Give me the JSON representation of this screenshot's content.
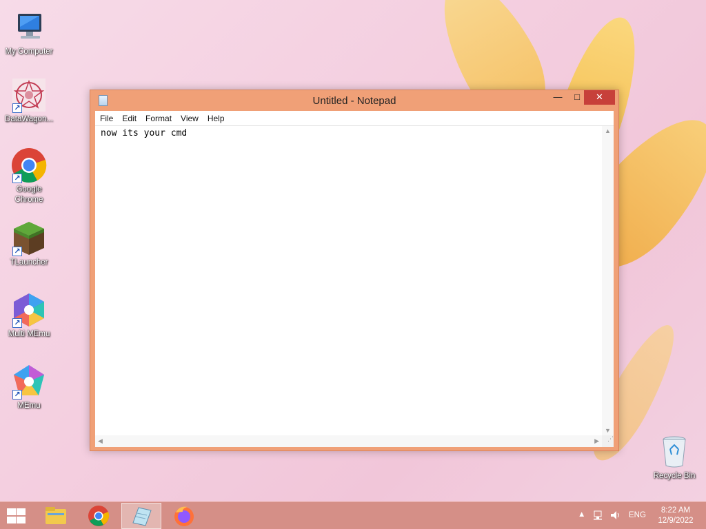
{
  "desktop": {
    "icons": [
      {
        "label": "My Computer"
      },
      {
        "label": "DataWagon..."
      },
      {
        "label": "Google Chrome"
      },
      {
        "label": "TLauncher"
      },
      {
        "label": "Multi MEmu"
      },
      {
        "label": "MEmu"
      },
      {
        "label": "Recycle Bin"
      }
    ]
  },
  "window": {
    "title": "Untitled - Notepad",
    "controls": {
      "minimize": "—",
      "maximize": "□",
      "close": "✕"
    },
    "menu": [
      "File",
      "Edit",
      "Format",
      "View",
      "Help"
    ],
    "content": "now its your cmd"
  },
  "taskbar": {
    "pinned": [
      "file-explorer-icon",
      "chrome-icon",
      "notepad-icon",
      "firefox-icon"
    ],
    "tray": {
      "language": "ENG",
      "time": "8:22 AM",
      "date": "12/9/2022"
    }
  },
  "colors": {
    "window_frame": "#f0a077",
    "taskbar": "#d58f87",
    "close_button": "#c7403a"
  }
}
